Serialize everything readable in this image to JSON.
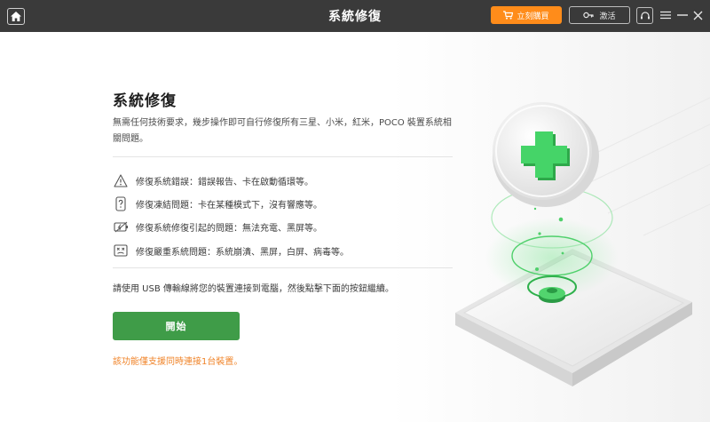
{
  "titlebar": {
    "title": "系統修復",
    "buy_label": "立刻購買",
    "activate_label": "激活"
  },
  "icons": {
    "home": "home-icon",
    "cart": "cart-icon",
    "key": "key-icon",
    "support": "headset-icon",
    "menu": "menu-icon",
    "minimize": "minimize-icon",
    "close": "close-icon"
  },
  "colors": {
    "titlebar_bg": "#3a3a3a",
    "buy_button": "#ff8c1a",
    "start_button": "#3f9c48",
    "note_text": "#f0842a",
    "accent_green": "#3ec45a"
  },
  "main": {
    "heading": "系統修復",
    "description": "無需任何技術要求，幾步操作即可自行修復所有三星、小米，紅米，POCO 裝置系統相關問題。",
    "features": [
      {
        "icon": "warning-icon",
        "text": "修復系統錯誤：錯誤報告、卡在啟動循環等。"
      },
      {
        "icon": "phone-question-icon",
        "text": "修復凍結問題：卡在某種模式下，沒有響應等。"
      },
      {
        "icon": "battery-icon",
        "text": "修復系統修復引起的問題：無法充電、黑屏等。"
      },
      {
        "icon": "crash-icon",
        "text": "修復嚴重系統問題：系統崩潰、黑屏，白屏、病毒等。"
      }
    ],
    "instruction": "請使用 USB 傳輸線將您的裝置連接到電腦，然後點擊下面的按鈕繼續。",
    "start_label": "開始",
    "note": "該功能僅支援同時連接1台裝置。"
  }
}
